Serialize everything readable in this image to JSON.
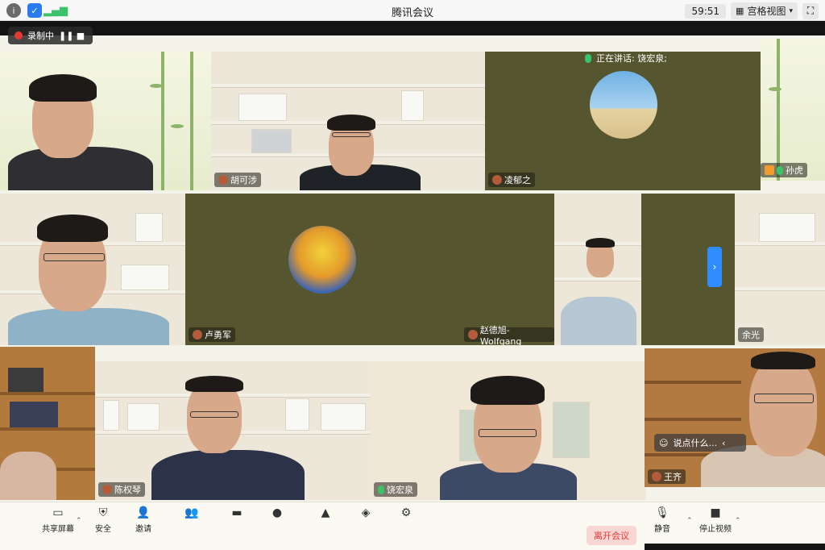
{
  "window": {
    "title": "腾讯会议",
    "timer": "59:51",
    "view_label": "宫格视图"
  },
  "recording": {
    "label": "录制中"
  },
  "speaking": {
    "label": "正在讲话: 饶宏泉;"
  },
  "chat_prompt": {
    "text": "说点什么..."
  },
  "participants": [
    {
      "name": "胡可涉"
    },
    {
      "name": "凌郁之"
    },
    {
      "name": "孙虎"
    },
    {
      "name": "卢勇军"
    },
    {
      "name": "赵德旭-Wolfgang"
    },
    {
      "name": "余光"
    },
    {
      "name": "陈权琴"
    },
    {
      "name": "饶宏泉"
    },
    {
      "name": "王齐"
    }
  ],
  "toolbar": {
    "share": "共享屏幕",
    "security": "安全",
    "invite": "邀请",
    "mute": "静音",
    "video": "停止视频",
    "leave": "离开会议"
  },
  "colors": {
    "accent": "#2f8dff",
    "record": "#e53935",
    "mic_on": "#3cc26b",
    "video_off_bg": "#55562f"
  }
}
